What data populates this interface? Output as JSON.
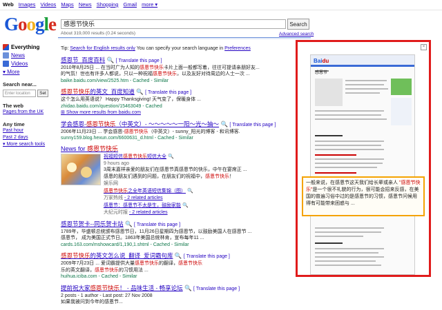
{
  "topnav": {
    "items": [
      "Web",
      "Images",
      "Videos",
      "Maps",
      "News",
      "Shopping",
      "Gmail",
      "more ▾"
    ]
  },
  "logo": {
    "text": "Google"
  },
  "search": {
    "query": "感恩节快乐",
    "button": "Search",
    "advanced": "Advanced search",
    "results_count": "About 319,000 results (0.24 seconds)"
  },
  "sidebar": {
    "items": [
      {
        "label": "Everything",
        "icon": "everything-icon",
        "color": "#d62d20"
      },
      {
        "label": "News",
        "icon": "news-icon",
        "color": "#1a57d6"
      },
      {
        "label": "Videos",
        "icon": "videos-icon",
        "color": "#1a57d6"
      },
      {
        "label": "▾ More",
        "icon": "more-icon",
        "color": "#fff"
      }
    ],
    "search_near": "Search near...",
    "location_placeholder": "Enter location",
    "set_button": "Set",
    "web_head": "The web",
    "pages_uk": "Pages from the UK",
    "anytime_head": "Any time",
    "past_hour": "Past hour",
    "past_2_days": "Past 2 days",
    "more_tools": "More search tools"
  },
  "tip": {
    "prefix": "Tip: ",
    "link1": "Search for English results only",
    "middle": " You can specify your search language in ",
    "link2": "Preferences"
  },
  "results": [
    {
      "title": "感恩节_百度百科",
      "translate": "[ Translate this page ]",
      "snippet1": "2010年8月25日 ... 在当时广为人知的感恩节快乐卡片上面一般都写着，往往可提请亲朋好友...",
      "snippet2": "的气氛！世也有许多人都说，只以一种祝福感恩节快乐，以及友好对待周边的人士一次 ...",
      "url": "baike.baidu.com/view/2525.htm - Cached - Similar"
    },
    {
      "title": "感恩节快乐的英文_百度知道",
      "translate": "[ Translate this page ]",
      "snippet1": "这个怎么用英语说？ Happy Thanksgiving! 天气变了，保暖身体 ...",
      "snippet2": "zhidao.baidu.com/question/15463049 - Cached",
      "url": "Show more results from baidu.com"
    },
    {
      "title": "学会感恩-感恩节快乐（中英文）- 〜〜〜〜〜一阳〜光〜抽〜",
      "translate": "[ Translate this page ]",
      "snippet1": "2006年11月23日 ... 学会感恩-感恩节快乐（中英文）- sunny_阳光的博客 - 和讯博客.",
      "snippet2": "",
      "url": "sunny159.blog.hexun.com/6600631_d.html - Cached - Similar"
    }
  ],
  "news": {
    "heading": "News for 感恩节快乐",
    "item1_title": "祝福短信感恩节快乐短信大全",
    "item1_meta": "9 hours ago",
    "item1_snippet1": "3周末嘉祥亲爱的朋友们在感恩节真感恩节的快乐，中午在宴席正 ...",
    "item1_snippet2": "感恩的朋友们遇到的问题，在朋友们的祝福中，感恩节快乐！",
    "item1_source": "娱乐网",
    "item2_title": "感恩节快乐之全年英语短信集锦（图）",
    "item2_source": "万家热线",
    "item2_related": "- 2 related articles",
    "item3_title": "感恩节：感恩节不太是生，鼓励家能",
    "item3_source": "大纪元时报",
    "item3_related": "- 2 related articles"
  },
  "results2": [
    {
      "title": "感恩节贺卡--同乐贺卡站",
      "translate": "[ Translate this page ]",
      "snippet1": "1789年，华盛顿总统颁布感恩节日，11月26日星期四为感恩节，以鼓励美国人在感恩节 ...",
      "snippet2": "感恩节， 成为美国正式节日。1863年美国总统林肯，宣布每年11 ...",
      "url": "cards.163.com/mshowcard/1,190,1.shtml - Cached - Similar"
    },
    {
      "title": "感恩节快乐的英文怎么说_翻译_爱词霸句库",
      "translate": "[ Translate this page ]",
      "snippet1": "2009年7月23日 ... 爱词霸提供大量感恩节快乐的翻译，感恩节快乐",
      "snippet2": "乐的英文翻译，感恩节快乐的习惯用法 ...",
      "url": "huihua.iciba.com - Cached - Similar"
    },
    {
      "title": "提前祝大家感恩节快乐！ - 品味生活 - 畅享论坛",
      "translate": "[ Translate this page ]",
      "snippet1": "2 posts - 1 author - Last post: 27 Nov 2008",
      "snippet2": "如果我被问到今年的感恩节...",
      "url": ""
    }
  ],
  "preview": {
    "header_text": "感恩节",
    "zoom_text1": "一般来说，在感恩节这天我们给长辈或亲人 ",
    "zoom_hl": "\"感恩节快乐\"",
    "zoom_text2": "是一个很不礼貌的行为，很可能会招来反感，在美国的普遍习俗中过的是感恩节的习惯，感恩节问候用得有可能带来困惑与 ..."
  }
}
